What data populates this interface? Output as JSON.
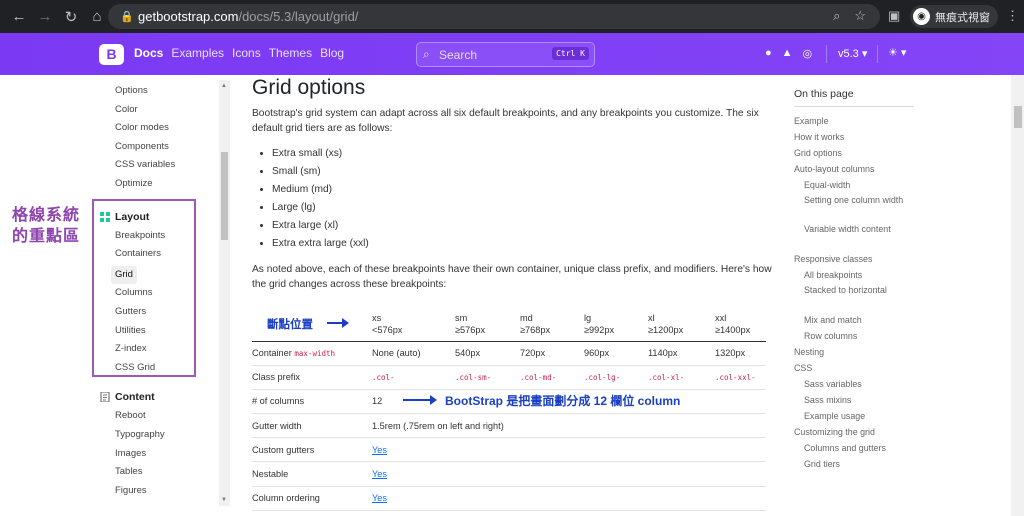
{
  "browser": {
    "url_host": "getbootstrap.com",
    "url_path": "/docs/5.3/layout/grid/",
    "profile_label": "無痕式視窗"
  },
  "navbar": {
    "brand": "B",
    "links": [
      "Docs",
      "Examples",
      "Icons",
      "Themes",
      "Blog"
    ],
    "search_placeholder": "Search",
    "search_kbd": "Ctrl K",
    "version": "v5.3",
    "theme": "☀"
  },
  "sidebar": {
    "top_items": [
      "Options",
      "Color",
      "Color modes",
      "Components",
      "CSS variables",
      "Optimize"
    ],
    "layout_title": "Layout",
    "layout_items": [
      "Breakpoints",
      "Containers",
      "Grid",
      "Columns",
      "Gutters",
      "Utilities",
      "Z-index",
      "CSS Grid"
    ],
    "content_title": "Content",
    "content_items": [
      "Reboot",
      "Typography",
      "Images",
      "Tables",
      "Figures"
    ]
  },
  "annotation_left": [
    "格線系統",
    "的重點區"
  ],
  "main": {
    "title": "Grid options",
    "intro": "Bootstrap's grid system can adapt across all six default breakpoints, and any breakpoints you customize. The six default grid tiers are as follows:",
    "tiers": [
      "Extra small (xs)",
      "Small (sm)",
      "Medium (md)",
      "Large (lg)",
      "Extra large (xl)",
      "Extra extra large (xxl)"
    ],
    "note": "As noted above, each of these breakpoints have their own container, unique class prefix, and modifiers. Here's how the grid changes across these breakpoints:"
  },
  "table": {
    "headers": [
      {
        "name": "xs",
        "size": "<576px"
      },
      {
        "name": "sm",
        "size": "≥576px"
      },
      {
        "name": "md",
        "size": "≥768px"
      },
      {
        "name": "lg",
        "size": "≥992px"
      },
      {
        "name": "xl",
        "size": "≥1200px"
      },
      {
        "name": "xxl",
        "size": "≥1400px"
      }
    ],
    "container_label": "Container",
    "container_code": "max-width",
    "container_values": [
      "None (auto)",
      "540px",
      "720px",
      "960px",
      "1140px",
      "1320px"
    ],
    "prefix_label": "Class prefix",
    "prefix_values": [
      ".col-",
      ".col-sm-",
      ".col-md-",
      ".col-lg-",
      ".col-xl-",
      ".col-xxl-"
    ],
    "columns_label": "# of columns",
    "columns_value": "12",
    "gutter_label": "Gutter width",
    "gutter_value": "1.5rem (.75rem on left and right)",
    "custom_label": "Custom gutters",
    "custom_value": "Yes",
    "nestable_label": "Nestable",
    "nestable_value": "Yes",
    "ordering_label": "Column ordering",
    "ordering_value": "Yes"
  },
  "annotation_bp": "斷點位置",
  "annotation_columns": "BootStrap 是把畫面劃分成 12 欄位 column",
  "toc": {
    "title": "On this page",
    "items": [
      {
        "label": "Example",
        "sub": false
      },
      {
        "label": "How it works",
        "sub": false
      },
      {
        "label": "Grid options",
        "sub": false
      },
      {
        "label": "Auto-layout columns",
        "sub": false
      },
      {
        "label": "Equal-width",
        "sub": true
      },
      {
        "label": "Setting one column width",
        "sub": true
      },
      {
        "label": "Variable width content",
        "sub": true
      },
      {
        "label": "Responsive classes",
        "sub": false
      },
      {
        "label": "All breakpoints",
        "sub": true
      },
      {
        "label": "Stacked to horizontal",
        "sub": true
      },
      {
        "label": "Mix and match",
        "sub": true
      },
      {
        "label": "Row columns",
        "sub": true
      },
      {
        "label": "Nesting",
        "sub": false
      },
      {
        "label": "CSS",
        "sub": false
      },
      {
        "label": "Sass variables",
        "sub": true
      },
      {
        "label": "Sass mixins",
        "sub": true
      },
      {
        "label": "Example usage",
        "sub": true
      },
      {
        "label": "Customizing the grid",
        "sub": false
      },
      {
        "label": "Columns and gutters",
        "sub": true
      },
      {
        "label": "Grid tiers",
        "sub": true
      }
    ]
  },
  "colors": {
    "brand": "#7b39f3",
    "annotation_purple": "#8e44ad",
    "annotation_blue": "#1a3fc4"
  }
}
